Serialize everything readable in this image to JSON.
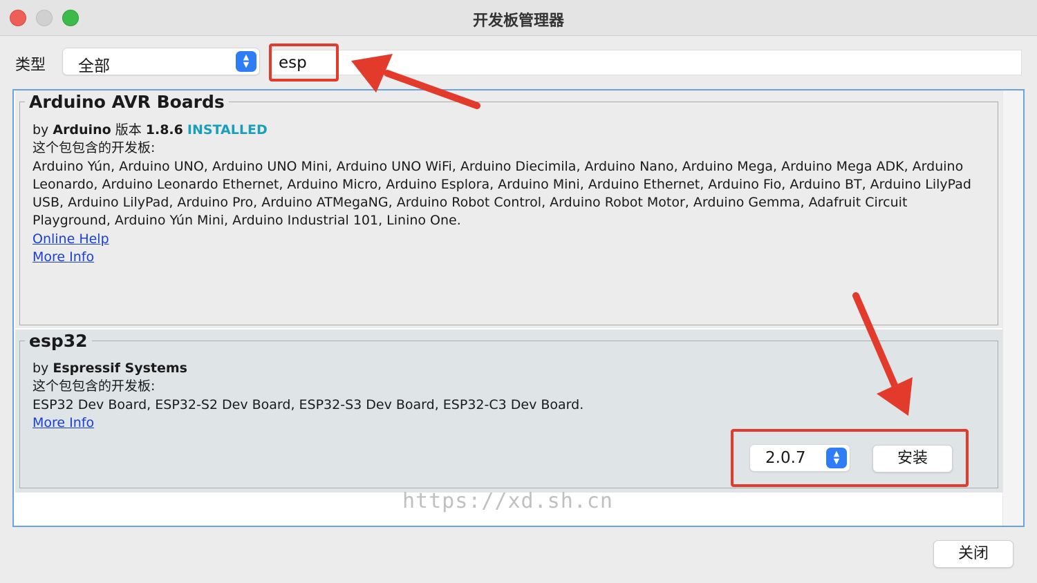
{
  "window": {
    "title": "开发板管理器"
  },
  "filter": {
    "type_label": "类型",
    "type_value": "全部",
    "search_value": "esp"
  },
  "entries": [
    {
      "name": "Arduino AVR Boards",
      "by_prefix": "by",
      "author": "Arduino",
      "version_label": "版本",
      "version": "1.8.6",
      "status": "INSTALLED",
      "boards_label": "这个包包含的开发板:",
      "boards": "Arduino Yún, Arduino UNO, Arduino UNO Mini, Arduino UNO WiFi, Arduino Diecimila, Arduino Nano, Arduino Mega, Arduino Mega ADK, Arduino Leonardo, Arduino Leonardo Ethernet, Arduino Micro, Arduino Esplora, Arduino Mini, Arduino Ethernet, Arduino Fio, Arduino BT, Arduino LilyPad USB, Arduino LilyPad, Arduino Pro, Arduino ATMegaNG, Arduino Robot Control, Arduino Robot Motor, Arduino Gemma, Adafruit Circuit Playground, Arduino Yún Mini, Arduino Industrial 101, Linino One.",
      "online_help": "Online Help",
      "more_info": "More Info"
    },
    {
      "name": "esp32",
      "by_prefix": "by",
      "author": "Espressif Systems",
      "boards_label": "这个包包含的开发板:",
      "boards": "ESP32 Dev Board, ESP32-S2 Dev Board, ESP32-S3 Dev Board, ESP32-C3 Dev Board.",
      "more_info": "More Info",
      "selected_version": "2.0.7",
      "install_label": "安装"
    }
  ],
  "footer": {
    "close_label": "关闭"
  },
  "watermark": "https://xd.sh.cn",
  "colors": {
    "accent": "#2f7df6",
    "installed": "#1a9fb8",
    "link": "#1a3fd6",
    "annotation": "#e23b2c"
  },
  "icons": {
    "stepper": "chevron-up-down-icon",
    "annotation_arrows": "red-arrow-icon"
  }
}
